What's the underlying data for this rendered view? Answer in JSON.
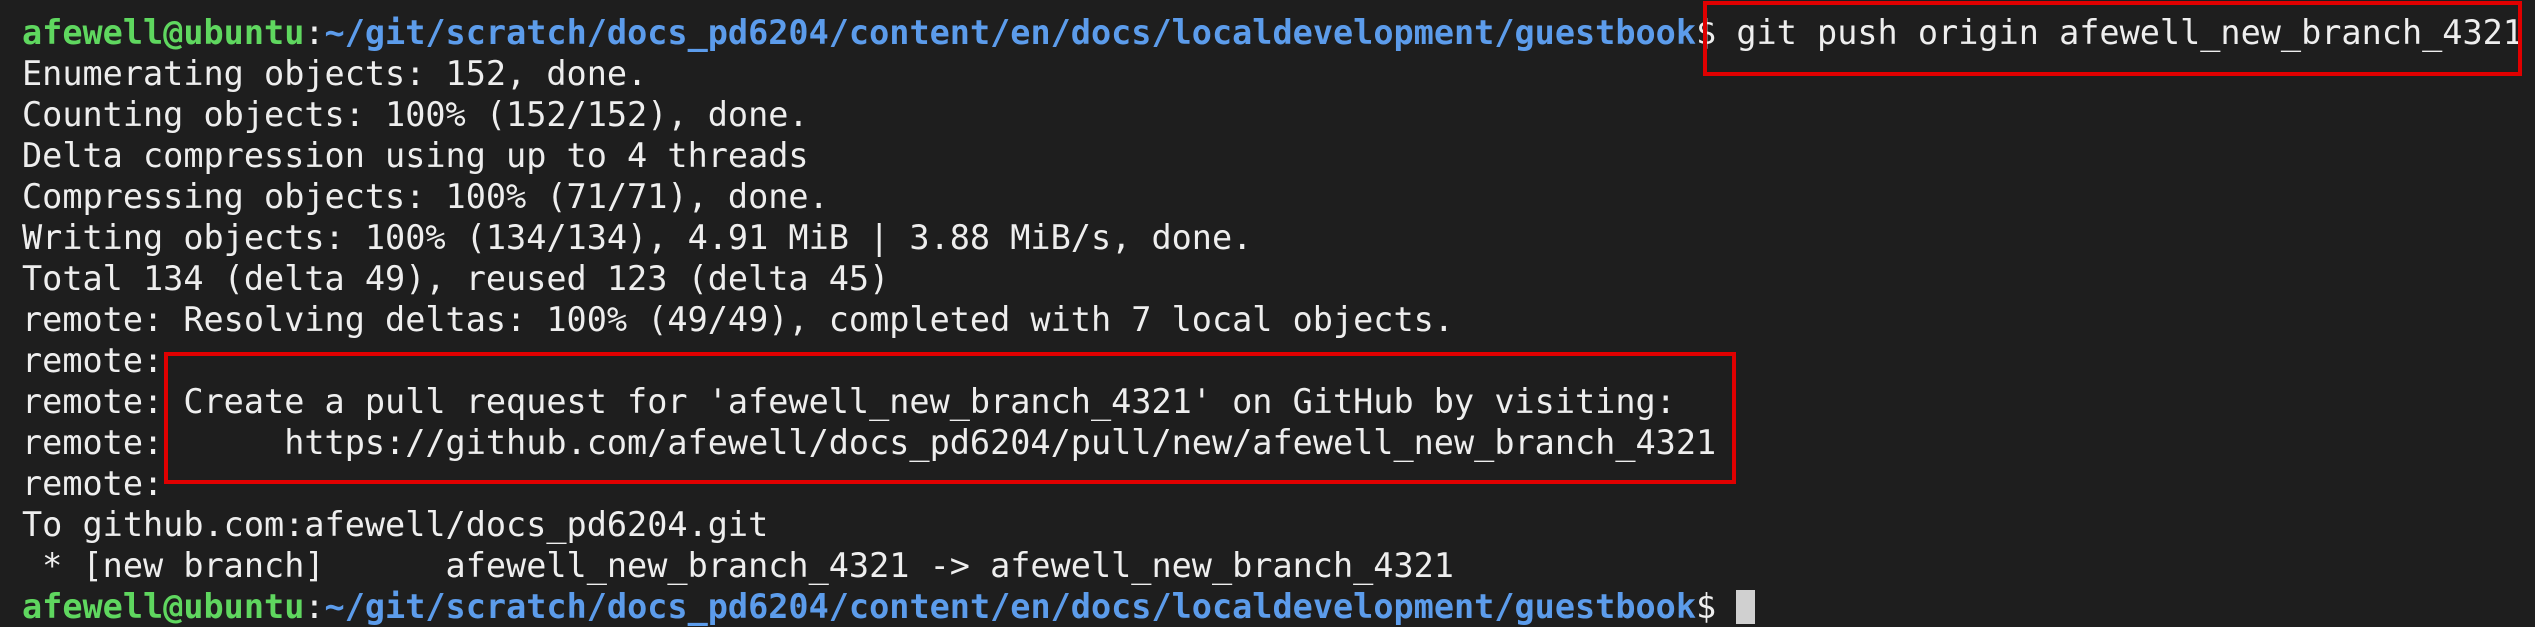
{
  "prompt": {
    "user_host": "afewell@ubuntu",
    "separator": ":",
    "path": "~/git/scratch/docs_pd6204/content/en/docs/localdevelopment/guestbook",
    "symbol": "$ "
  },
  "command": "git push origin afewell_new_branch_4321",
  "output_lines": [
    "Enumerating objects: 152, done.",
    "Counting objects: 100% (152/152), done.",
    "Delta compression using up to 4 threads",
    "Compressing objects: 100% (71/71), done.",
    "Writing objects: 100% (134/134), 4.91 MiB | 3.88 MiB/s, done.",
    "Total 134 (delta 49), reused 123 (delta 45)",
    "remote: Resolving deltas: 100% (49/49), completed with 7 local objects.",
    "remote: ",
    "remote: Create a pull request for 'afewell_new_branch_4321' on GitHub by visiting:",
    "remote:      https://github.com/afewell/docs_pd6204/pull/new/afewell_new_branch_4321",
    "remote: ",
    "To github.com:afewell/docs_pd6204.git",
    " * [new branch]      afewell_new_branch_4321 -> afewell_new_branch_4321"
  ],
  "colors": {
    "background": "#1e1e1e",
    "text": "#eeeeee",
    "user": "#5fd75f",
    "path": "#5c9ceb",
    "highlight": "#e00000"
  }
}
